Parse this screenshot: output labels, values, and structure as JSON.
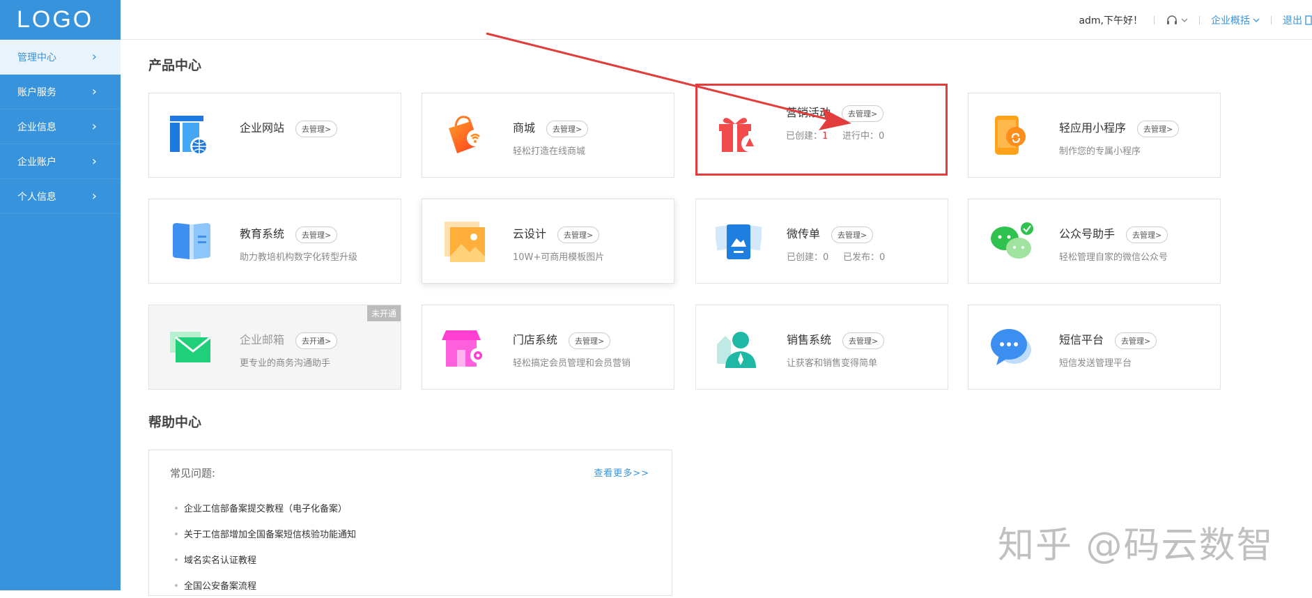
{
  "brand": {
    "logo": "LOGO"
  },
  "sidebar": {
    "items": [
      {
        "label": "管理中心",
        "active": true
      },
      {
        "label": "账户服务"
      },
      {
        "label": "企业信息"
      },
      {
        "label": "企业账户"
      },
      {
        "label": "个人信息"
      }
    ]
  },
  "header": {
    "greeting": "adm,下午好！",
    "overview": "企业概括",
    "logout": "退出"
  },
  "product_center": {
    "title": "产品中心",
    "cards": [
      {
        "name": "企业网站",
        "button": "去管理>",
        "desc": ""
      },
      {
        "name": "商城",
        "button": "去管理>",
        "desc": "轻松打造在线商城"
      },
      {
        "name": "营销活动",
        "button": "去管理>",
        "created_label": "已创建：",
        "created_value": "1",
        "progress_label": "进行中：",
        "progress_value": "0"
      },
      {
        "name": "轻应用小程序",
        "button": "去管理>",
        "desc": "制作您的专属小程序"
      },
      {
        "name": "教育系统",
        "button": "去管理>",
        "desc": "助力教培机构数字化转型升级"
      },
      {
        "name": "云设计",
        "button": "去管理>",
        "desc": "10W+可商用模板图片"
      },
      {
        "name": "微传单",
        "button": "去管理>",
        "created_label": "已创建：",
        "created_value": "0",
        "published_label": "已发布：",
        "published_value": "0"
      },
      {
        "name": "公众号助手",
        "button": "去管理>",
        "desc": "轻松管理自家的微信公众号"
      },
      {
        "name": "企业邮箱",
        "button": "去开通>",
        "desc": "更专业的商务沟通助手",
        "badge": "未开通"
      },
      {
        "name": "门店系统",
        "button": "去管理>",
        "desc": "轻松搞定会员管理和会员营销"
      },
      {
        "name": "销售系统",
        "button": "去管理>",
        "desc": "让获客和销售变得简单"
      },
      {
        "name": "短信平台",
        "button": "去管理>",
        "desc": "短信发送管理平台"
      }
    ]
  },
  "help_center": {
    "title": "帮助中心",
    "faq_heading": "常见问题:",
    "more": "查看更多>>",
    "items": [
      "企业工信部备案提交教程（电子化备案）",
      "关于工信部增加全国备案短信核验功能通知",
      "域名实名认证教程",
      "全国公安备案流程"
    ]
  },
  "watermark": "知乎 @码云数智",
  "colors": {
    "sidebar": "#3793db",
    "highlight": "#e23c3c",
    "accent": "#3793db"
  }
}
